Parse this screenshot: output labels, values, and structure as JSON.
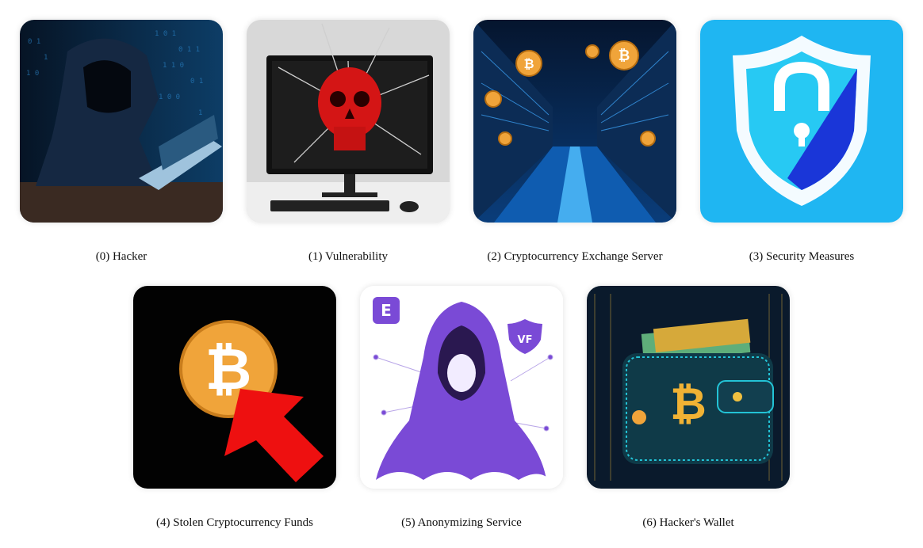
{
  "items": [
    {
      "caption": "(0) Hacker",
      "icon": "hacker-icon"
    },
    {
      "caption": "(1) Vulnerability",
      "icon": "skull-monitor-icon"
    },
    {
      "caption": "(2) Cryptocurrency Exchange Server",
      "icon": "server-room-icon"
    },
    {
      "caption": "(3) Security Measures",
      "icon": "shield-lock-icon"
    },
    {
      "caption": "(4) Stolen Cryptocurrency Funds",
      "icon": "bitcoin-arrow-icon"
    },
    {
      "caption": "(5) Anonymizing Service",
      "icon": "hooded-figure-icon"
    },
    {
      "caption": "(6) Hacker's Wallet",
      "icon": "bitcoin-wallet-icon"
    }
  ],
  "icon_glyphs": {
    "bitcoin": "₿",
    "anon_badge": "VF"
  },
  "colors": {
    "hacker_bg": "#0a2a4a",
    "shield_bg": "#1fb6f2",
    "anon_purple": "#7a4ad6",
    "bitcoin_gold": "#f0a43a",
    "arrow_red": "#ee1010"
  }
}
